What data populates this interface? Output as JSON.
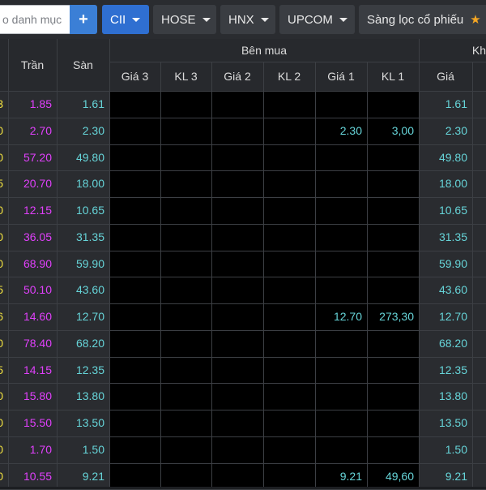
{
  "toolbar": {
    "search_placeholder": "o danh mục",
    "add_icon": "+",
    "dropdowns": [
      {
        "label": "CII",
        "active": true
      },
      {
        "label": "HOSE",
        "active": false
      },
      {
        "label": "HNX",
        "active": false
      },
      {
        "label": "UPCOM",
        "active": false
      },
      {
        "label": "Sàng lọc cổ phiếu",
        "active": false
      }
    ],
    "star_icon": "★"
  },
  "table": {
    "headers": {
      "tran": "Trần",
      "san": "Sàn",
      "ben_mua": "Bên mua",
      "gia3": "Giá 3",
      "kl3": "KL 3",
      "gia2": "Giá 2",
      "kl2": "KL 2",
      "gia1": "Giá 1",
      "kl1": "KL 1",
      "khop": "Kh",
      "khop_gia": "Giá"
    },
    "ref_digits": [
      "3",
      "0",
      "0",
      "5",
      "0",
      "0",
      "0",
      "5",
      "6",
      "0",
      "5",
      "0",
      "0",
      "0",
      "0"
    ],
    "rows": [
      {
        "tran": "1.85",
        "san": "1.61",
        "gia1": "",
        "kl1": "",
        "khop_gia": "1.61"
      },
      {
        "tran": "2.70",
        "san": "2.30",
        "gia1": "2.30",
        "kl1": "3,00",
        "khop_gia": "2.30"
      },
      {
        "tran": "57.20",
        "san": "49.80",
        "gia1": "",
        "kl1": "",
        "khop_gia": "49.80"
      },
      {
        "tran": "20.70",
        "san": "18.00",
        "gia1": "",
        "kl1": "",
        "khop_gia": "18.00"
      },
      {
        "tran": "12.15",
        "san": "10.65",
        "gia1": "",
        "kl1": "",
        "khop_gia": "10.65"
      },
      {
        "tran": "36.05",
        "san": "31.35",
        "gia1": "",
        "kl1": "",
        "khop_gia": "31.35"
      },
      {
        "tran": "68.90",
        "san": "59.90",
        "gia1": "",
        "kl1": "",
        "khop_gia": "59.90"
      },
      {
        "tran": "50.10",
        "san": "43.60",
        "gia1": "",
        "kl1": "",
        "khop_gia": "43.60"
      },
      {
        "tran": "14.60",
        "san": "12.70",
        "gia1": "12.70",
        "kl1": "273,30",
        "khop_gia": "12.70"
      },
      {
        "tran": "78.40",
        "san": "68.20",
        "gia1": "",
        "kl1": "",
        "khop_gia": "68.20"
      },
      {
        "tran": "14.15",
        "san": "12.35",
        "gia1": "",
        "kl1": "",
        "khop_gia": "12.35"
      },
      {
        "tran": "15.80",
        "san": "13.80",
        "gia1": "",
        "kl1": "",
        "khop_gia": "13.80"
      },
      {
        "tran": "15.50",
        "san": "13.50",
        "gia1": "",
        "kl1": "",
        "khop_gia": "13.50"
      },
      {
        "tran": "1.70",
        "san": "1.50",
        "gia1": "",
        "kl1": "",
        "khop_gia": "1.50"
      },
      {
        "tran": "10.55",
        "san": "9.21",
        "gia1": "9.21",
        "kl1": "49,60",
        "khop_gia": "9.21"
      }
    ]
  },
  "colors": {
    "ceiling": "#e040fb",
    "floor": "#66d4d8",
    "reference": "#f0e040",
    "accent": "#2f6fd1"
  }
}
